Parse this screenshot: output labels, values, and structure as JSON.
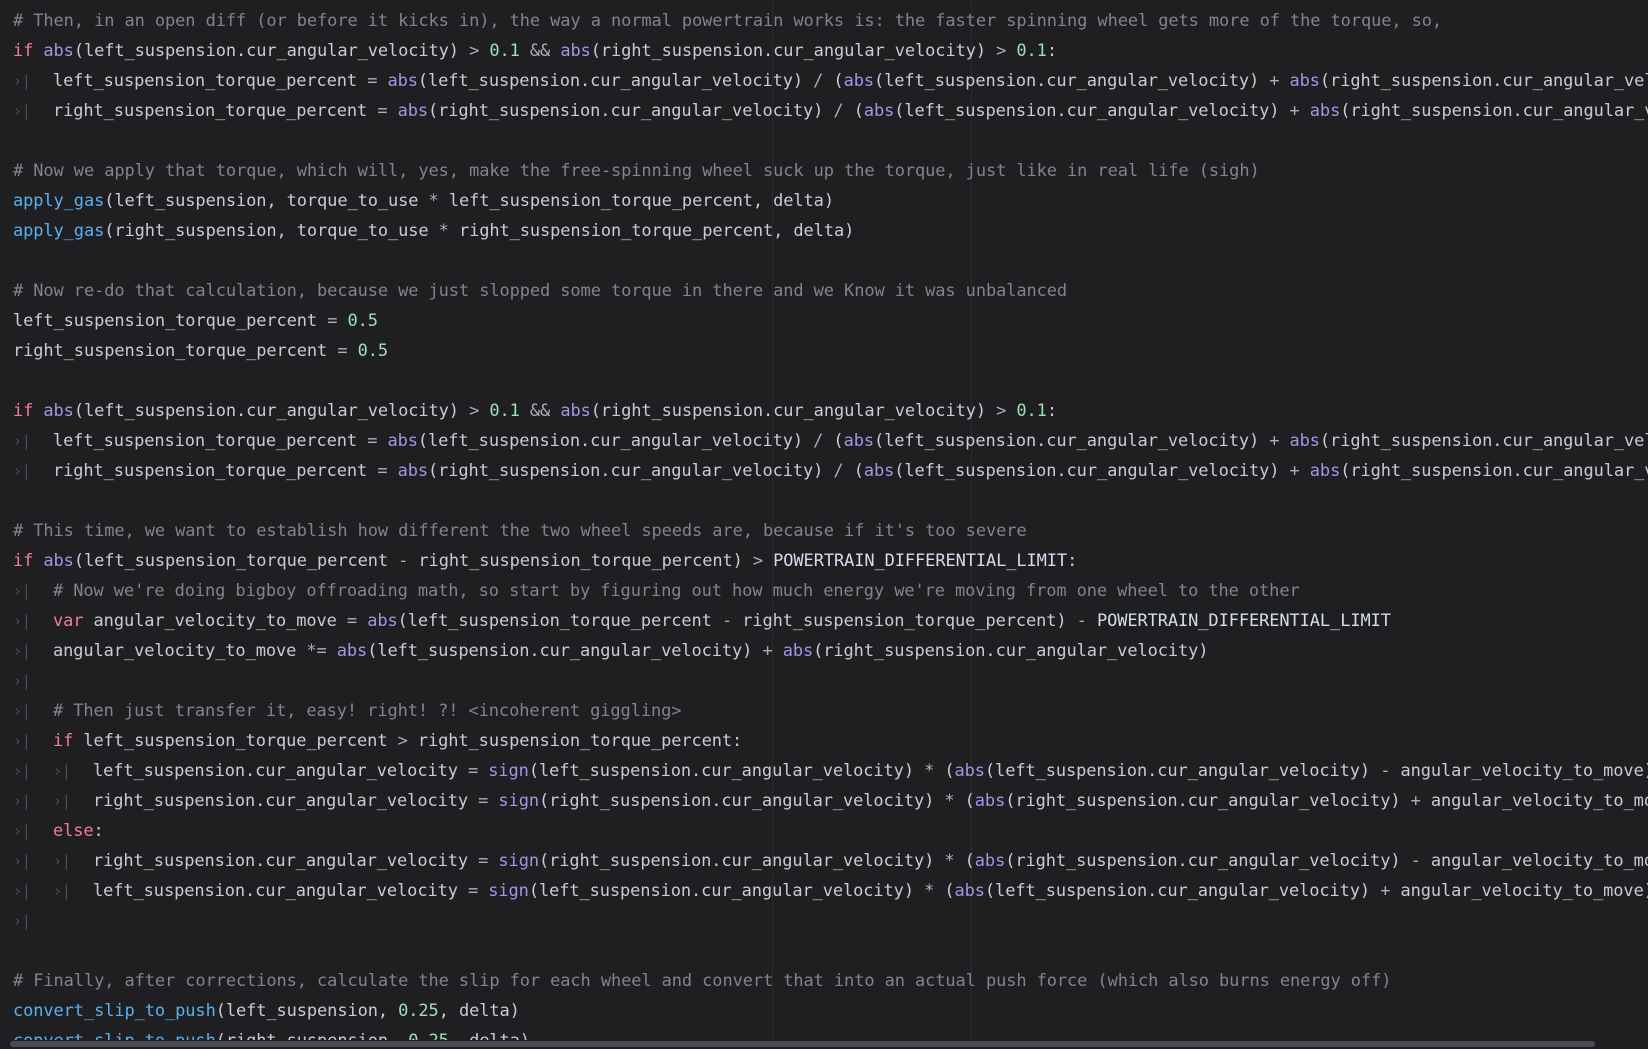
{
  "editor": {
    "lines": [
      [
        {
          "t": "com",
          "v": "# Then, in an open diff (or before it kicks in), the way a normal powertrain works is: the faster spinning wheel gets more of the torque, so,"
        }
      ],
      [
        {
          "t": "kw",
          "v": "if "
        },
        {
          "t": "builtin",
          "v": "abs"
        },
        {
          "t": "id",
          "v": "(left_suspension.cur_angular_velocity) "
        },
        {
          "t": "op",
          "v": "> "
        },
        {
          "t": "num",
          "v": "0.1"
        },
        {
          "t": "op",
          "v": " && "
        },
        {
          "t": "builtin",
          "v": "abs"
        },
        {
          "t": "id",
          "v": "(right_suspension.cur_angular_velocity) "
        },
        {
          "t": "op",
          "v": "> "
        },
        {
          "t": "num",
          "v": "0.1"
        },
        {
          "t": "id",
          "v": ":"
        }
      ],
      [
        {
          "t": "tab",
          "v": "›|"
        },
        {
          "t": "id",
          "v": "left_suspension_torque_percent "
        },
        {
          "t": "op",
          "v": "= "
        },
        {
          "t": "builtin",
          "v": "abs"
        },
        {
          "t": "id",
          "v": "(left_suspension.cur_angular_velocity) "
        },
        {
          "t": "op",
          "v": "/ "
        },
        {
          "t": "id",
          "v": "("
        },
        {
          "t": "builtin",
          "v": "abs"
        },
        {
          "t": "id",
          "v": "(left_suspension.cur_angular_velocity) "
        },
        {
          "t": "op",
          "v": "+ "
        },
        {
          "t": "builtin",
          "v": "abs"
        },
        {
          "t": "id",
          "v": "(right_suspension.cur_angular_veloc"
        }
      ],
      [
        {
          "t": "tab",
          "v": "›|"
        },
        {
          "t": "id",
          "v": "right_suspension_torque_percent "
        },
        {
          "t": "op",
          "v": "= "
        },
        {
          "t": "builtin",
          "v": "abs"
        },
        {
          "t": "id",
          "v": "(right_suspension.cur_angular_velocity) "
        },
        {
          "t": "op",
          "v": "/ "
        },
        {
          "t": "id",
          "v": "("
        },
        {
          "t": "builtin",
          "v": "abs"
        },
        {
          "t": "id",
          "v": "(left_suspension.cur_angular_velocity) "
        },
        {
          "t": "op",
          "v": "+ "
        },
        {
          "t": "builtin",
          "v": "abs"
        },
        {
          "t": "id",
          "v": "(right_suspension.cur_angular_vel"
        }
      ],
      [],
      [
        {
          "t": "com",
          "v": "# Now we apply that torque, which will, yes, make the free-spinning wheel suck up the torque, just like in real life (sigh)"
        }
      ],
      [
        {
          "t": "fn",
          "v": "apply_gas"
        },
        {
          "t": "id",
          "v": "(left_suspension, torque_to_use "
        },
        {
          "t": "op",
          "v": "* "
        },
        {
          "t": "id",
          "v": "left_suspension_torque_percent, delta)"
        }
      ],
      [
        {
          "t": "fn",
          "v": "apply_gas"
        },
        {
          "t": "id",
          "v": "(right_suspension, torque_to_use "
        },
        {
          "t": "op",
          "v": "* "
        },
        {
          "t": "id",
          "v": "right_suspension_torque_percent, delta)"
        }
      ],
      [],
      [
        {
          "t": "com",
          "v": "# Now re-do that calculation, because we just slopped some torque in there and we Know it was unbalanced"
        }
      ],
      [
        {
          "t": "id",
          "v": "left_suspension_torque_percent "
        },
        {
          "t": "op",
          "v": "= "
        },
        {
          "t": "num",
          "v": "0.5"
        }
      ],
      [
        {
          "t": "id",
          "v": "right_suspension_torque_percent "
        },
        {
          "t": "op",
          "v": "= "
        },
        {
          "t": "num",
          "v": "0.5"
        }
      ],
      [],
      [
        {
          "t": "kw",
          "v": "if "
        },
        {
          "t": "builtin",
          "v": "abs"
        },
        {
          "t": "id",
          "v": "(left_suspension.cur_angular_velocity) "
        },
        {
          "t": "op",
          "v": "> "
        },
        {
          "t": "num",
          "v": "0.1"
        },
        {
          "t": "op",
          "v": " && "
        },
        {
          "t": "builtin",
          "v": "abs"
        },
        {
          "t": "id",
          "v": "(right_suspension.cur_angular_velocity) "
        },
        {
          "t": "op",
          "v": "> "
        },
        {
          "t": "num",
          "v": "0.1"
        },
        {
          "t": "id",
          "v": ":"
        }
      ],
      [
        {
          "t": "tab",
          "v": "›|"
        },
        {
          "t": "id",
          "v": "left_suspension_torque_percent "
        },
        {
          "t": "op",
          "v": "= "
        },
        {
          "t": "builtin",
          "v": "abs"
        },
        {
          "t": "id",
          "v": "(left_suspension.cur_angular_velocity) "
        },
        {
          "t": "op",
          "v": "/ "
        },
        {
          "t": "id",
          "v": "("
        },
        {
          "t": "builtin",
          "v": "abs"
        },
        {
          "t": "id",
          "v": "(left_suspension.cur_angular_velocity) "
        },
        {
          "t": "op",
          "v": "+ "
        },
        {
          "t": "builtin",
          "v": "abs"
        },
        {
          "t": "id",
          "v": "(right_suspension.cur_angular_veloc"
        }
      ],
      [
        {
          "t": "tab",
          "v": "›|"
        },
        {
          "t": "id",
          "v": "right_suspension_torque_percent "
        },
        {
          "t": "op",
          "v": "= "
        },
        {
          "t": "builtin",
          "v": "abs"
        },
        {
          "t": "id",
          "v": "(right_suspension.cur_angular_velocity) "
        },
        {
          "t": "op",
          "v": "/ "
        },
        {
          "t": "id",
          "v": "("
        },
        {
          "t": "builtin",
          "v": "abs"
        },
        {
          "t": "id",
          "v": "(left_suspension.cur_angular_velocity) "
        },
        {
          "t": "op",
          "v": "+ "
        },
        {
          "t": "builtin",
          "v": "abs"
        },
        {
          "t": "id",
          "v": "(right_suspension.cur_angular_vel"
        }
      ],
      [],
      [
        {
          "t": "com",
          "v": "# This time, we want to establish how different the two wheel speeds are, because if it's too severe"
        }
      ],
      [
        {
          "t": "kw",
          "v": "if "
        },
        {
          "t": "builtin",
          "v": "abs"
        },
        {
          "t": "id",
          "v": "(left_suspension_torque_percent "
        },
        {
          "t": "op",
          "v": "- "
        },
        {
          "t": "id",
          "v": "right_suspension_torque_percent) "
        },
        {
          "t": "op",
          "v": "> "
        },
        {
          "t": "const",
          "v": "POWERTRAIN_DIFFERENTIAL_LIMIT"
        },
        {
          "t": "id",
          "v": ":"
        }
      ],
      [
        {
          "t": "tab",
          "v": "›|"
        },
        {
          "t": "com",
          "v": "# Now we're doing bigboy offroading math, so start by figuring out how much energy we're moving from one wheel to the other"
        }
      ],
      [
        {
          "t": "tab",
          "v": "›|"
        },
        {
          "t": "var",
          "v": "var "
        },
        {
          "t": "id",
          "v": "angular_velocity_to_move "
        },
        {
          "t": "op",
          "v": "= "
        },
        {
          "t": "builtin",
          "v": "abs"
        },
        {
          "t": "id",
          "v": "(left_suspension_torque_percent "
        },
        {
          "t": "op",
          "v": "- "
        },
        {
          "t": "id",
          "v": "right_suspension_torque_percent) "
        },
        {
          "t": "op",
          "v": "- "
        },
        {
          "t": "const",
          "v": "POWERTRAIN_DIFFERENTIAL_LIMIT"
        }
      ],
      [
        {
          "t": "tab",
          "v": "›|"
        },
        {
          "t": "id",
          "v": "angular_velocity_to_move "
        },
        {
          "t": "op",
          "v": "*= "
        },
        {
          "t": "builtin",
          "v": "abs"
        },
        {
          "t": "id",
          "v": "(left_suspension.cur_angular_velocity) "
        },
        {
          "t": "op",
          "v": "+ "
        },
        {
          "t": "builtin",
          "v": "abs"
        },
        {
          "t": "id",
          "v": "(right_suspension.cur_angular_velocity)"
        }
      ],
      [
        {
          "t": "tab",
          "v": "›|"
        }
      ],
      [
        {
          "t": "tab",
          "v": "›|"
        },
        {
          "t": "com",
          "v": "# Then just transfer it, easy! right! ?! <incoherent giggling>"
        }
      ],
      [
        {
          "t": "tab",
          "v": "›|"
        },
        {
          "t": "kw",
          "v": "if "
        },
        {
          "t": "id",
          "v": "left_suspension_torque_percent "
        },
        {
          "t": "op",
          "v": "> "
        },
        {
          "t": "id",
          "v": "right_suspension_torque_percent:"
        }
      ],
      [
        {
          "t": "tab",
          "v": "›|"
        },
        {
          "t": "tab",
          "v": "›|"
        },
        {
          "t": "id",
          "v": "left_suspension.cur_angular_velocity "
        },
        {
          "t": "op",
          "v": "= "
        },
        {
          "t": "builtin",
          "v": "sign"
        },
        {
          "t": "id",
          "v": "(left_suspension.cur_angular_velocity) "
        },
        {
          "t": "op",
          "v": "* "
        },
        {
          "t": "id",
          "v": "("
        },
        {
          "t": "builtin",
          "v": "abs"
        },
        {
          "t": "id",
          "v": "(left_suspension.cur_angular_velocity) "
        },
        {
          "t": "op",
          "v": "- "
        },
        {
          "t": "id",
          "v": "angular_velocity_to_move)"
        }
      ],
      [
        {
          "t": "tab",
          "v": "›|"
        },
        {
          "t": "tab",
          "v": "›|"
        },
        {
          "t": "id",
          "v": "right_suspension.cur_angular_velocity "
        },
        {
          "t": "op",
          "v": "= "
        },
        {
          "t": "builtin",
          "v": "sign"
        },
        {
          "t": "id",
          "v": "(right_suspension.cur_angular_velocity) "
        },
        {
          "t": "op",
          "v": "* "
        },
        {
          "t": "id",
          "v": "("
        },
        {
          "t": "builtin",
          "v": "abs"
        },
        {
          "t": "id",
          "v": "(right_suspension.cur_angular_velocity) "
        },
        {
          "t": "op",
          "v": "+ "
        },
        {
          "t": "id",
          "v": "angular_velocity_to_move"
        }
      ],
      [
        {
          "t": "tab",
          "v": "›|"
        },
        {
          "t": "kw",
          "v": "else"
        },
        {
          "t": "id",
          "v": ":"
        }
      ],
      [
        {
          "t": "tab",
          "v": "›|"
        },
        {
          "t": "tab",
          "v": "›|"
        },
        {
          "t": "id",
          "v": "right_suspension.cur_angular_velocity "
        },
        {
          "t": "op",
          "v": "= "
        },
        {
          "t": "builtin",
          "v": "sign"
        },
        {
          "t": "id",
          "v": "(right_suspension.cur_angular_velocity) "
        },
        {
          "t": "op",
          "v": "* "
        },
        {
          "t": "id",
          "v": "("
        },
        {
          "t": "builtin",
          "v": "abs"
        },
        {
          "t": "id",
          "v": "(right_suspension.cur_angular_velocity) "
        },
        {
          "t": "op",
          "v": "- "
        },
        {
          "t": "id",
          "v": "angular_velocity_to_move"
        }
      ],
      [
        {
          "t": "tab",
          "v": "›|"
        },
        {
          "t": "tab",
          "v": "›|"
        },
        {
          "t": "id",
          "v": "left_suspension.cur_angular_velocity "
        },
        {
          "t": "op",
          "v": "= "
        },
        {
          "t": "builtin",
          "v": "sign"
        },
        {
          "t": "id",
          "v": "(left_suspension.cur_angular_velocity) "
        },
        {
          "t": "op",
          "v": "* "
        },
        {
          "t": "id",
          "v": "("
        },
        {
          "t": "builtin",
          "v": "abs"
        },
        {
          "t": "id",
          "v": "(left_suspension.cur_angular_velocity) "
        },
        {
          "t": "op",
          "v": "+ "
        },
        {
          "t": "id",
          "v": "angular_velocity_to_move)"
        }
      ],
      [
        {
          "t": "tab",
          "v": "›|"
        }
      ],
      [],
      [
        {
          "t": "com",
          "v": "# Finally, after corrections, calculate the slip for each wheel and convert that into an actual push force (which also burns energy off)"
        }
      ],
      [
        {
          "t": "fn",
          "v": "convert_slip_to_push"
        },
        {
          "t": "id",
          "v": "(left_suspension, "
        },
        {
          "t": "num",
          "v": "0.25"
        },
        {
          "t": "id",
          "v": ", delta)"
        }
      ],
      [
        {
          "t": "fn",
          "v": "convert_slip_to_push"
        },
        {
          "t": "id",
          "v": "(right_suspension, "
        },
        {
          "t": "num",
          "v": "0.25"
        },
        {
          "t": "id",
          "v": ", delta)"
        }
      ]
    ]
  },
  "colors": {
    "background": "#1f1f21",
    "comment": "#7f848e",
    "keyword": "#f07aa5",
    "builtin": "#a593e8",
    "function": "#58b0f0",
    "number": "#9de0b8"
  }
}
